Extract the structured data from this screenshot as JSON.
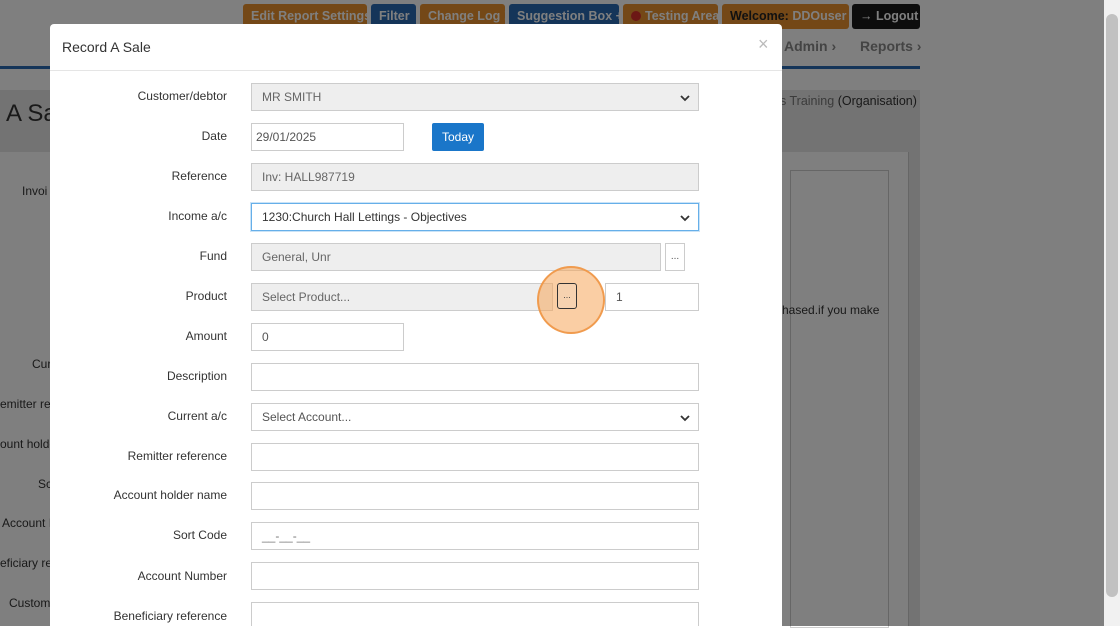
{
  "topbar": {
    "edit_report_settings": "Edit Report Settings",
    "filter": "Filter",
    "change_log": "Change Log",
    "suggestion_box": "Suggestion Box",
    "testing_area": "Testing Area",
    "welcome_label": "Welcome:",
    "welcome_user": "DDOuser",
    "logout": "Logout"
  },
  "nav": {
    "admin": "Admin ›",
    "reports": "Reports ›"
  },
  "background": {
    "page_title": "A Sa",
    "org_name": "s Training",
    "org_type": "(Organisation)",
    "partial_labels": [
      "Invoi",
      "Cur",
      "emitter re",
      "ount holde",
      "Sc",
      "Account I",
      "eficiary re",
      "Custom"
    ],
    "partial_note": "hased.if you make"
  },
  "modal": {
    "title": "Record A Sale",
    "close_symbol": "×",
    "fields": {
      "customer": {
        "label": "Customer/debtor",
        "value": "MR SMITH"
      },
      "date": {
        "label": "Date",
        "value": "29/01/2025",
        "button": "Today"
      },
      "reference": {
        "label": "Reference",
        "value": "Inv: HALL987719"
      },
      "income": {
        "label": "Income a/c",
        "value": "1230:Church Hall Lettings - Objectives"
      },
      "fund": {
        "label": "Fund",
        "value": "General, Unr",
        "button": "..."
      },
      "product": {
        "label": "Product",
        "placeholder": "Select Product...",
        "button": "...",
        "quantity": "1"
      },
      "amount": {
        "label": "Amount",
        "value": "0"
      },
      "description": {
        "label": "Description",
        "value": ""
      },
      "current_ac": {
        "label": "Current a/c",
        "placeholder": "Select Account..."
      },
      "remitter": {
        "label": "Remitter reference",
        "value": ""
      },
      "holder": {
        "label": "Account holder name",
        "value": ""
      },
      "sort_code": {
        "label": "Sort Code",
        "placeholder": "__-__-__"
      },
      "account_no": {
        "label": "Account Number",
        "value": ""
      },
      "beneficiary": {
        "label": "Beneficiary reference",
        "value": ""
      }
    }
  },
  "colors": {
    "orange_button": "#e8912f",
    "blue_button": "#2a6bb3",
    "today_button": "#1a76c9",
    "highlight": "#f5a55a"
  }
}
